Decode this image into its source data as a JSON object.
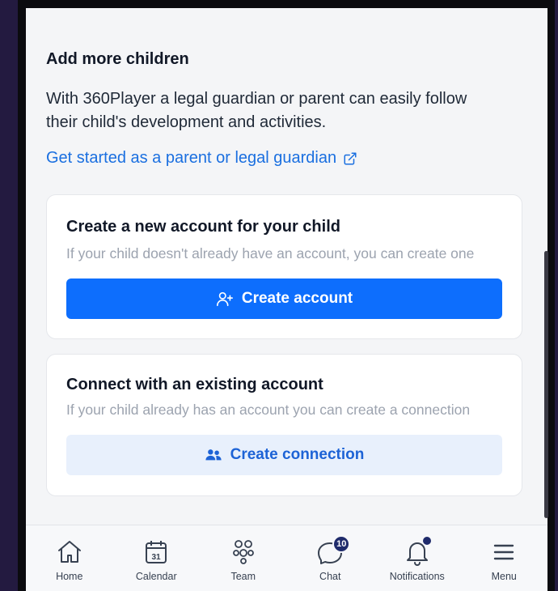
{
  "section": {
    "title": "Add more children",
    "description": "With 360Player a legal guardian or parent can easily follow their child's development and activities.",
    "link_label": "Get started as a parent or legal guardian"
  },
  "cards": [
    {
      "title": "Create a new account for your child",
      "description": "If your child doesn't already have an account, you can create one",
      "button_label": "Create account",
      "button_icon": "user-plus-icon"
    },
    {
      "title": "Connect with an existing account",
      "description": "If your child already has an account you can create a connection",
      "button_label": "Create connection",
      "button_icon": "users-icon"
    }
  ],
  "nav": {
    "items": [
      {
        "label": "Home",
        "icon": "home-icon"
      },
      {
        "label": "Calendar",
        "icon": "calendar-icon",
        "day": "31"
      },
      {
        "label": "Team",
        "icon": "team-icon"
      },
      {
        "label": "Chat",
        "icon": "chat-icon",
        "badge": "10"
      },
      {
        "label": "Notifications",
        "icon": "bell-icon"
      },
      {
        "label": "Menu",
        "icon": "hamburger-icon"
      }
    ]
  },
  "colors": {
    "primary": "#0d6efd",
    "link": "#1a6fe0",
    "secondary_bg": "#e8f0fc",
    "badge": "#1f2b6b",
    "backdrop": "#231a40"
  }
}
